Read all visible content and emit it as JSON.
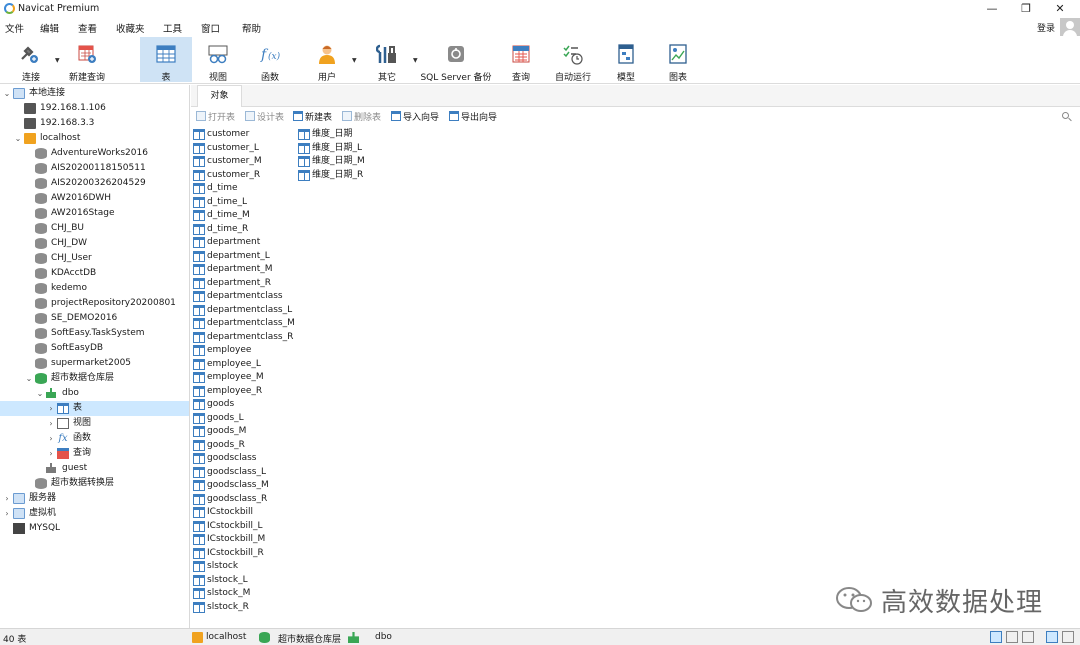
{
  "window": {
    "title": "Navicat Premium",
    "controls": {
      "minimize": "—",
      "restore": "❐",
      "close": "✕"
    }
  },
  "menu": [
    "文件",
    "编辑",
    "查看",
    "收藏夹",
    "工具",
    "窗口",
    "帮助"
  ],
  "account": {
    "login_label": "登录"
  },
  "toolbar": {
    "tools": [
      {
        "label": "连接",
        "icon": "connection-icon",
        "has_dropdown": true
      },
      {
        "label": "新建查询",
        "icon": "new-query-icon"
      },
      {
        "label": "表",
        "icon": "table-icon",
        "active": true
      },
      {
        "label": "视图",
        "icon": "view-icon"
      },
      {
        "label": "函数",
        "icon": "function-icon"
      },
      {
        "label": "用户",
        "icon": "user-icon",
        "has_dropdown": true
      },
      {
        "label": "其它",
        "icon": "other-tools-icon",
        "has_dropdown": true
      },
      {
        "label": "SQL Server 备份",
        "icon": "backup-icon"
      },
      {
        "label": "查询",
        "icon": "query-icon"
      },
      {
        "label": "自动运行",
        "icon": "automation-icon"
      },
      {
        "label": "模型",
        "icon": "model-icon"
      },
      {
        "label": "图表",
        "icon": "chart-icon"
      }
    ]
  },
  "tree": [
    {
      "label": "本地连接",
      "icon": "folder-blue",
      "twisty": "v"
    },
    {
      "label": "192.168.1.106",
      "icon": "conn",
      "twisty": ""
    },
    {
      "label": "192.168.3.3",
      "icon": "conn",
      "twisty": ""
    },
    {
      "label": "localhost",
      "icon": "conn-mysql",
      "twisty": "v"
    },
    {
      "label": "AdventureWorks2016",
      "icon": "db",
      "twisty": ""
    },
    {
      "label": "AIS20200118150511",
      "icon": "db",
      "twisty": ""
    },
    {
      "label": "AIS20200326204529",
      "icon": "db",
      "twisty": ""
    },
    {
      "label": "AW2016DWH",
      "icon": "db",
      "twisty": ""
    },
    {
      "label": "AW2016Stage",
      "icon": "db",
      "twisty": ""
    },
    {
      "label": "CHJ_BU",
      "icon": "db",
      "twisty": ""
    },
    {
      "label": "CHJ_DW",
      "icon": "db",
      "twisty": ""
    },
    {
      "label": "CHJ_User",
      "icon": "db",
      "twisty": ""
    },
    {
      "label": "KDAcctDB",
      "icon": "db",
      "twisty": ""
    },
    {
      "label": "kedemo",
      "icon": "db",
      "twisty": ""
    },
    {
      "label": "projectRepository20200801",
      "icon": "db",
      "twisty": ""
    },
    {
      "label": "SE_DEMO2016",
      "icon": "db",
      "twisty": ""
    },
    {
      "label": "SoftEasy.TaskSystem",
      "icon": "db",
      "twisty": ""
    },
    {
      "label": "SoftEasyDB",
      "icon": "db",
      "twisty": ""
    },
    {
      "label": "supermarket2005",
      "icon": "db",
      "twisty": ""
    },
    {
      "label": "超市数据仓库层",
      "icon": "db-green",
      "twisty": "v"
    },
    {
      "label": "dbo",
      "icon": "schema",
      "twisty": "v"
    },
    {
      "label": "表",
      "icon": "table",
      "twisty": ">",
      "selected": true
    },
    {
      "label": "视图",
      "icon": "view",
      "twisty": ">"
    },
    {
      "label": "函数",
      "icon": "func",
      "twisty": ">"
    },
    {
      "label": "查询",
      "icon": "query",
      "twisty": ">"
    },
    {
      "label": "guest",
      "icon": "schema-gray",
      "twisty": ""
    },
    {
      "label": "超市数据转换层",
      "icon": "db",
      "twisty": ""
    },
    {
      "label": "服务器",
      "icon": "folder-blue",
      "twisty": ">"
    },
    {
      "label": "虚拟机",
      "icon": "folder-blue",
      "twisty": ">"
    },
    {
      "label": "MYSQL",
      "icon": "mysql",
      "twisty": ""
    }
  ],
  "tabs": {
    "objects": "对象"
  },
  "object_toolbar": [
    {
      "label": "打开表",
      "enabled": false
    },
    {
      "label": "设计表",
      "enabled": false
    },
    {
      "label": "新建表",
      "enabled": true
    },
    {
      "label": "删除表",
      "enabled": false
    },
    {
      "label": "导入向导",
      "enabled": true
    },
    {
      "label": "导出向导",
      "enabled": true
    }
  ],
  "objects": {
    "column1": [
      "customer",
      "customer_L",
      "customer_M",
      "customer_R",
      "d_time",
      "d_time_L",
      "d_time_M",
      "d_time_R",
      "department",
      "department_L",
      "department_M",
      "department_R",
      "departmentclass",
      "departmentclass_L",
      "departmentclass_M",
      "departmentclass_R",
      "employee",
      "employee_L",
      "employee_M",
      "employee_R",
      "goods",
      "goods_L",
      "goods_M",
      "goods_R",
      "goodsclass",
      "goodsclass_L",
      "goodsclass_M",
      "goodsclass_R",
      "ICstockbill",
      "ICstockbill_L",
      "ICstockbill_M",
      "ICstockbill_R",
      "slstock",
      "slstock_L",
      "slstock_M",
      "slstock_R"
    ],
    "column2": [
      "维度_日期",
      "维度_日期_L",
      "维度_日期_M",
      "维度_日期_R"
    ]
  },
  "watermark": {
    "text": "高效数据处理"
  },
  "status": {
    "count": "40 表",
    "connection": "localhost",
    "database": "超市数据仓库层",
    "schema": "dbo"
  }
}
